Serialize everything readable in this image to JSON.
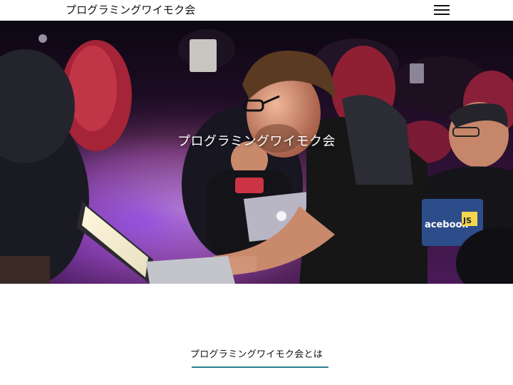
{
  "header": {
    "site_title": "プログラミングワイモク会",
    "menu_icon": "hamburger-menu-icon"
  },
  "hero": {
    "title": "プログラミングワイモク会"
  },
  "about": {
    "heading": "プログラミングワイモク会とは",
    "underline_color": "#2a7f8c"
  },
  "colors": {
    "header_bg": "#ffffff",
    "text": "#111111",
    "accent": "#2a7f8c"
  }
}
